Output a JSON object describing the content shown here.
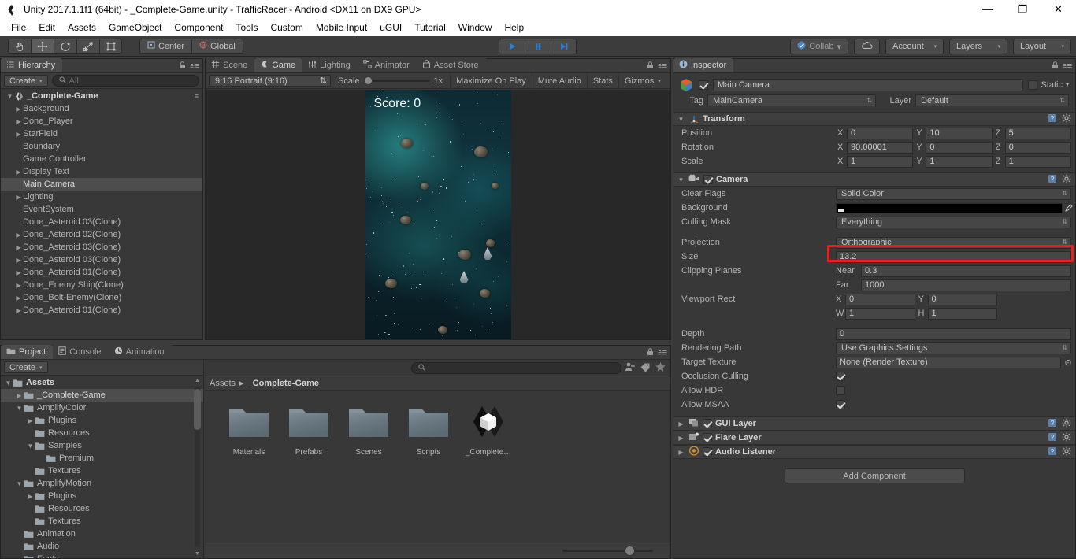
{
  "window": {
    "title": "Unity 2017.1.1f1 (64bit) - _Complete-Game.unity - TrafficRacer - Android <DX11 on DX9 GPU>",
    "minimize": "—",
    "maximize": "❐",
    "close": "✕"
  },
  "menubar": {
    "items": [
      "File",
      "Edit",
      "Assets",
      "GameObject",
      "Component",
      "Tools",
      "Custom",
      "Mobile Input",
      "uGUI",
      "Tutorial",
      "Window",
      "Help"
    ]
  },
  "toolbar": {
    "transform_tools": [
      "hand-tool",
      "move-tool",
      "rotate-tool",
      "scale-tool",
      "rect-tool"
    ],
    "active_tool": "move-tool",
    "pivot_label": "Center",
    "space_label": "Global",
    "play": "play",
    "pause": "pause",
    "step": "step",
    "collab_label": "Collab",
    "cloud_label": "cloud",
    "account_label": "Account",
    "layers_label": "Layers",
    "layout_label": "Layout"
  },
  "hierarchy": {
    "tab": "Hierarchy",
    "create_label": "Create",
    "search_placeholder": "All",
    "items": [
      {
        "label": "_Complete-Game",
        "depth": 0,
        "arrow": "down",
        "root": true,
        "selected": false
      },
      {
        "label": "Background",
        "depth": 1,
        "arrow": "right",
        "root": false,
        "selected": false
      },
      {
        "label": "Done_Player",
        "depth": 1,
        "arrow": "right",
        "root": false,
        "selected": false
      },
      {
        "label": "StarField",
        "depth": 1,
        "arrow": "right",
        "root": false,
        "selected": false
      },
      {
        "label": "Boundary",
        "depth": 1,
        "arrow": "none",
        "root": false,
        "selected": false
      },
      {
        "label": "Game Controller",
        "depth": 1,
        "arrow": "none",
        "root": false,
        "selected": false
      },
      {
        "label": "Display Text",
        "depth": 1,
        "arrow": "right",
        "root": false,
        "selected": false
      },
      {
        "label": "Main Camera",
        "depth": 1,
        "arrow": "none",
        "root": false,
        "selected": true
      },
      {
        "label": "Lighting",
        "depth": 1,
        "arrow": "right",
        "root": false,
        "selected": false
      },
      {
        "label": "EventSystem",
        "depth": 1,
        "arrow": "none",
        "root": false,
        "selected": false
      },
      {
        "label": "Done_Asteroid 03(Clone)",
        "depth": 1,
        "arrow": "none",
        "root": false,
        "selected": false
      },
      {
        "label": "Done_Asteroid 02(Clone)",
        "depth": 1,
        "arrow": "right",
        "root": false,
        "selected": false
      },
      {
        "label": "Done_Asteroid 03(Clone)",
        "depth": 1,
        "arrow": "right",
        "root": false,
        "selected": false
      },
      {
        "label": "Done_Asteroid 03(Clone)",
        "depth": 1,
        "arrow": "right",
        "root": false,
        "selected": false
      },
      {
        "label": "Done_Asteroid 01(Clone)",
        "depth": 1,
        "arrow": "right",
        "root": false,
        "selected": false
      },
      {
        "label": "Done_Enemy Ship(Clone)",
        "depth": 1,
        "arrow": "right",
        "root": false,
        "selected": false
      },
      {
        "label": "Done_Bolt-Enemy(Clone)",
        "depth": 1,
        "arrow": "right",
        "root": false,
        "selected": false
      },
      {
        "label": "Done_Asteroid 01(Clone)",
        "depth": 1,
        "arrow": "right",
        "root": false,
        "selected": false
      }
    ]
  },
  "center": {
    "tabs": [
      {
        "label": "Scene",
        "icon": "grid-icon",
        "active": false
      },
      {
        "label": "Game",
        "icon": "gamepad-icon",
        "active": true
      },
      {
        "label": "Lighting",
        "icon": "sliders-icon",
        "active": false
      },
      {
        "label": "Animator",
        "icon": "animator-icon",
        "active": false
      },
      {
        "label": "Asset Store",
        "icon": "store-icon",
        "active": false
      }
    ],
    "game_toolbar": {
      "aspect": "9:16 Portrait (9:16)",
      "scale_label": "Scale",
      "scale_value": "1x",
      "maximize_on_play": "Maximize On Play",
      "mute_audio": "Mute Audio",
      "stats": "Stats",
      "gizmos": "Gizmos"
    },
    "game_view": {
      "score_text": "Score: 0"
    }
  },
  "inspector": {
    "tab": "Inspector",
    "object": {
      "name": "Main Camera",
      "enabled": true,
      "static_label": "Static",
      "tag_label": "Tag",
      "tag_value": "MainCamera",
      "layer_label": "Layer",
      "layer_value": "Default"
    },
    "transform": {
      "title": "Transform",
      "rows": [
        {
          "label": "Position",
          "x": "0",
          "y": "10",
          "z": "5"
        },
        {
          "label": "Rotation",
          "x": "90.00001",
          "y": "0",
          "z": "0"
        },
        {
          "label": "Scale",
          "x": "1",
          "y": "1",
          "z": "1"
        }
      ],
      "axis_labels": [
        "X",
        "Y",
        "Z"
      ]
    },
    "camera": {
      "title": "Camera",
      "enabled": true,
      "clear_flags_label": "Clear Flags",
      "clear_flags_value": "Solid Color",
      "background_label": "Background",
      "background_color": "#000000",
      "culling_mask_label": "Culling Mask",
      "culling_mask_value": "Everything",
      "projection_label": "Projection",
      "projection_value": "Orthographic",
      "size_label": "Size",
      "size_value": "13.2",
      "size_highlight_color": "#f01c1c",
      "clipping_label": "Clipping Planes",
      "near_label": "Near",
      "near_value": "0.3",
      "far_label": "Far",
      "far_value": "1000",
      "viewport_label": "Viewport Rect",
      "viewport_x_label": "X",
      "viewport_x": "0",
      "viewport_y_label": "Y",
      "viewport_y": "0",
      "viewport_w_label": "W",
      "viewport_w": "1",
      "viewport_h_label": "H",
      "viewport_h": "1",
      "depth_label": "Depth",
      "depth_value": "0",
      "rendering_path_label": "Rendering Path",
      "rendering_path_value": "Use Graphics Settings",
      "target_texture_label": "Target Texture",
      "target_texture_value": "None (Render Texture)",
      "occlusion_label": "Occlusion Culling",
      "occlusion_checked": true,
      "hdr_label": "Allow HDR",
      "hdr_checked": false,
      "msaa_label": "Allow MSAA",
      "msaa_checked": true
    },
    "components": [
      {
        "title": "GUI Layer",
        "enabled": true,
        "icon": "gui-layer-icon"
      },
      {
        "title": "Flare Layer",
        "enabled": true,
        "icon": "flare-layer-icon"
      },
      {
        "title": "Audio Listener",
        "enabled": true,
        "icon": "audio-listener-icon"
      }
    ],
    "add_component_label": "Add Component"
  },
  "project": {
    "tabs": [
      {
        "label": "Project",
        "icon": "folder-icon",
        "active": true
      },
      {
        "label": "Console",
        "icon": "console-icon",
        "active": false
      },
      {
        "label": "Animation",
        "icon": "clock-icon",
        "active": false
      }
    ],
    "create_label": "Create",
    "search_placeholder": "",
    "tree": [
      {
        "label": "Assets",
        "depth": 0,
        "arrow": "down",
        "bold": true,
        "selected": false
      },
      {
        "label": "_Complete-Game",
        "depth": 1,
        "arrow": "right",
        "bold": false,
        "selected": true
      },
      {
        "label": "AmplifyColor",
        "depth": 1,
        "arrow": "down",
        "bold": false,
        "selected": false
      },
      {
        "label": "Plugins",
        "depth": 2,
        "arrow": "right",
        "bold": false,
        "selected": false
      },
      {
        "label": "Resources",
        "depth": 2,
        "arrow": "none",
        "bold": false,
        "selected": false
      },
      {
        "label": "Samples",
        "depth": 2,
        "arrow": "down",
        "bold": false,
        "selected": false
      },
      {
        "label": "Premium",
        "depth": 3,
        "arrow": "none",
        "bold": false,
        "selected": false
      },
      {
        "label": "Textures",
        "depth": 2,
        "arrow": "none",
        "bold": false,
        "selected": false
      },
      {
        "label": "AmplifyMotion",
        "depth": 1,
        "arrow": "down",
        "bold": false,
        "selected": false
      },
      {
        "label": "Plugins",
        "depth": 2,
        "arrow": "right",
        "bold": false,
        "selected": false
      },
      {
        "label": "Resources",
        "depth": 2,
        "arrow": "none",
        "bold": false,
        "selected": false
      },
      {
        "label": "Textures",
        "depth": 2,
        "arrow": "none",
        "bold": false,
        "selected": false
      },
      {
        "label": "Animation",
        "depth": 1,
        "arrow": "none",
        "bold": false,
        "selected": false
      },
      {
        "label": "Audio",
        "depth": 1,
        "arrow": "none",
        "bold": false,
        "selected": false
      },
      {
        "label": "Fonts",
        "depth": 1,
        "arrow": "none",
        "bold": false,
        "selected": false
      }
    ],
    "breadcrumb": {
      "root": "Assets",
      "separator": "▸",
      "current": "_Complete-Game"
    },
    "assets": [
      {
        "label": "Materials",
        "type": "folder"
      },
      {
        "label": "Prefabs",
        "type": "folder"
      },
      {
        "label": "Scenes",
        "type": "folder"
      },
      {
        "label": "Scripts",
        "type": "folder"
      },
      {
        "label": "_Complete…",
        "type": "unity-scene"
      }
    ]
  }
}
